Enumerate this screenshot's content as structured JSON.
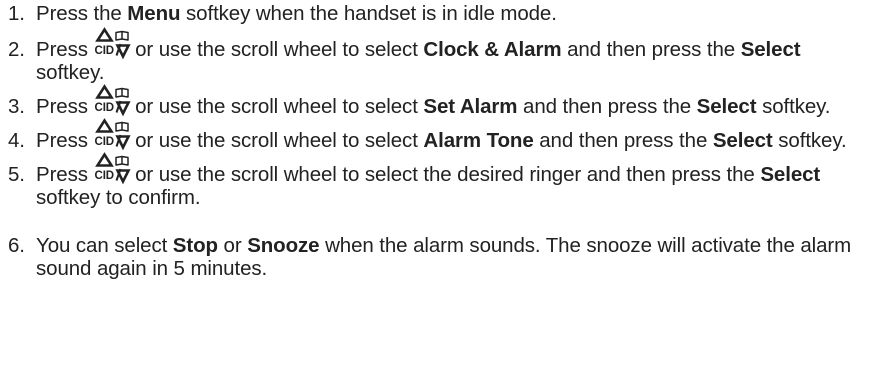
{
  "nav_key": {
    "up_icon": "triangle-up-icon",
    "cid_label": "CID",
    "book_icon": "phonebook-icon",
    "down_icon": "triangle-down-icon"
  },
  "steps": [
    {
      "number": "1.",
      "t1": "Press the ",
      "b1": "Menu",
      "t2": " softkey when the handset is in idle mode."
    },
    {
      "number": "2.",
      "t1": "Press ",
      "t2": " or use the scroll wheel to select ",
      "b1": "Clock & Alarm",
      "t3": " and then press the ",
      "b2": "Select",
      "t4": " softkey."
    },
    {
      "number": "3.",
      "t1": "Press ",
      "t2": " or use the scroll wheel to select ",
      "b1": "Set Alarm",
      "t3": " and then press the ",
      "b2": "Select",
      "t4": " softkey."
    },
    {
      "number": "4.",
      "t1": "Press ",
      "t2": " or use the scroll wheel to select ",
      "b1": "Alarm Tone",
      "t3": " and then press the ",
      "b2": "Select",
      "t4": " softkey."
    },
    {
      "number": "5.",
      "t1": "Press ",
      "t2": " or use the scroll wheel to select the desired ringer and then press the ",
      "b1": "Select",
      "t3": " softkey to confirm."
    },
    {
      "number": "6.",
      "t1": "You can select ",
      "b1": "Stop",
      "t2": " or ",
      "b2": "Snooze",
      "t3": " when the alarm sounds.  The snooze will activate the alarm sound again in 5 minutes."
    }
  ]
}
